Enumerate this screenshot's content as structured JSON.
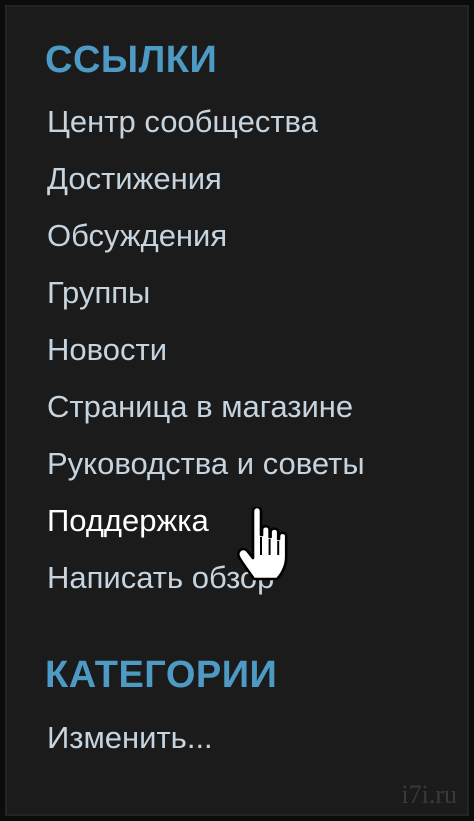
{
  "links_section": {
    "title": "ССЫЛКИ",
    "items": [
      {
        "label": "Центр сообщества"
      },
      {
        "label": "Достижения"
      },
      {
        "label": "Обсуждения"
      },
      {
        "label": "Группы"
      },
      {
        "label": "Новости"
      },
      {
        "label": "Страница в магазине"
      },
      {
        "label": "Руководства и советы"
      },
      {
        "label": "Поддержка"
      },
      {
        "label": "Написать обзор"
      }
    ]
  },
  "categories_section": {
    "title": "КАТЕГОРИИ",
    "edit_label": "Изменить..."
  },
  "watermark": "i7i.ru",
  "colors": {
    "section_title": "#4d9bc4",
    "link": "#c6d4df",
    "link_hover": "#ffffff",
    "panel_background": "#1b1b1c"
  }
}
